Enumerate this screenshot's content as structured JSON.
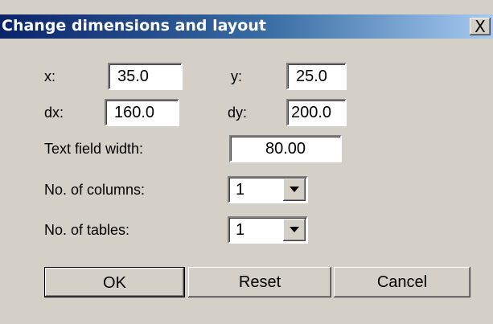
{
  "window": {
    "title": "Change dimensions and layout",
    "close_label": "X"
  },
  "fields": {
    "x_label": "x:",
    "x_value": "35.0",
    "y_label": "y:",
    "y_value": "25.0",
    "dx_label": "dx:",
    "dx_value": "160.0",
    "dy_label": "dy:",
    "dy_value": "200.0",
    "text_width_label": "Text field width:",
    "text_width_value": "80.00",
    "columns_label": "No. of columns:",
    "columns_value": "1",
    "tables_label": "No. of tables:",
    "tables_value": "1"
  },
  "buttons": {
    "ok": "OK",
    "reset": "Reset",
    "cancel": "Cancel"
  },
  "colors": {
    "dialog_bg": "#d4d0c8",
    "title_start": "#0a246a",
    "title_end": "#a6caf0"
  }
}
